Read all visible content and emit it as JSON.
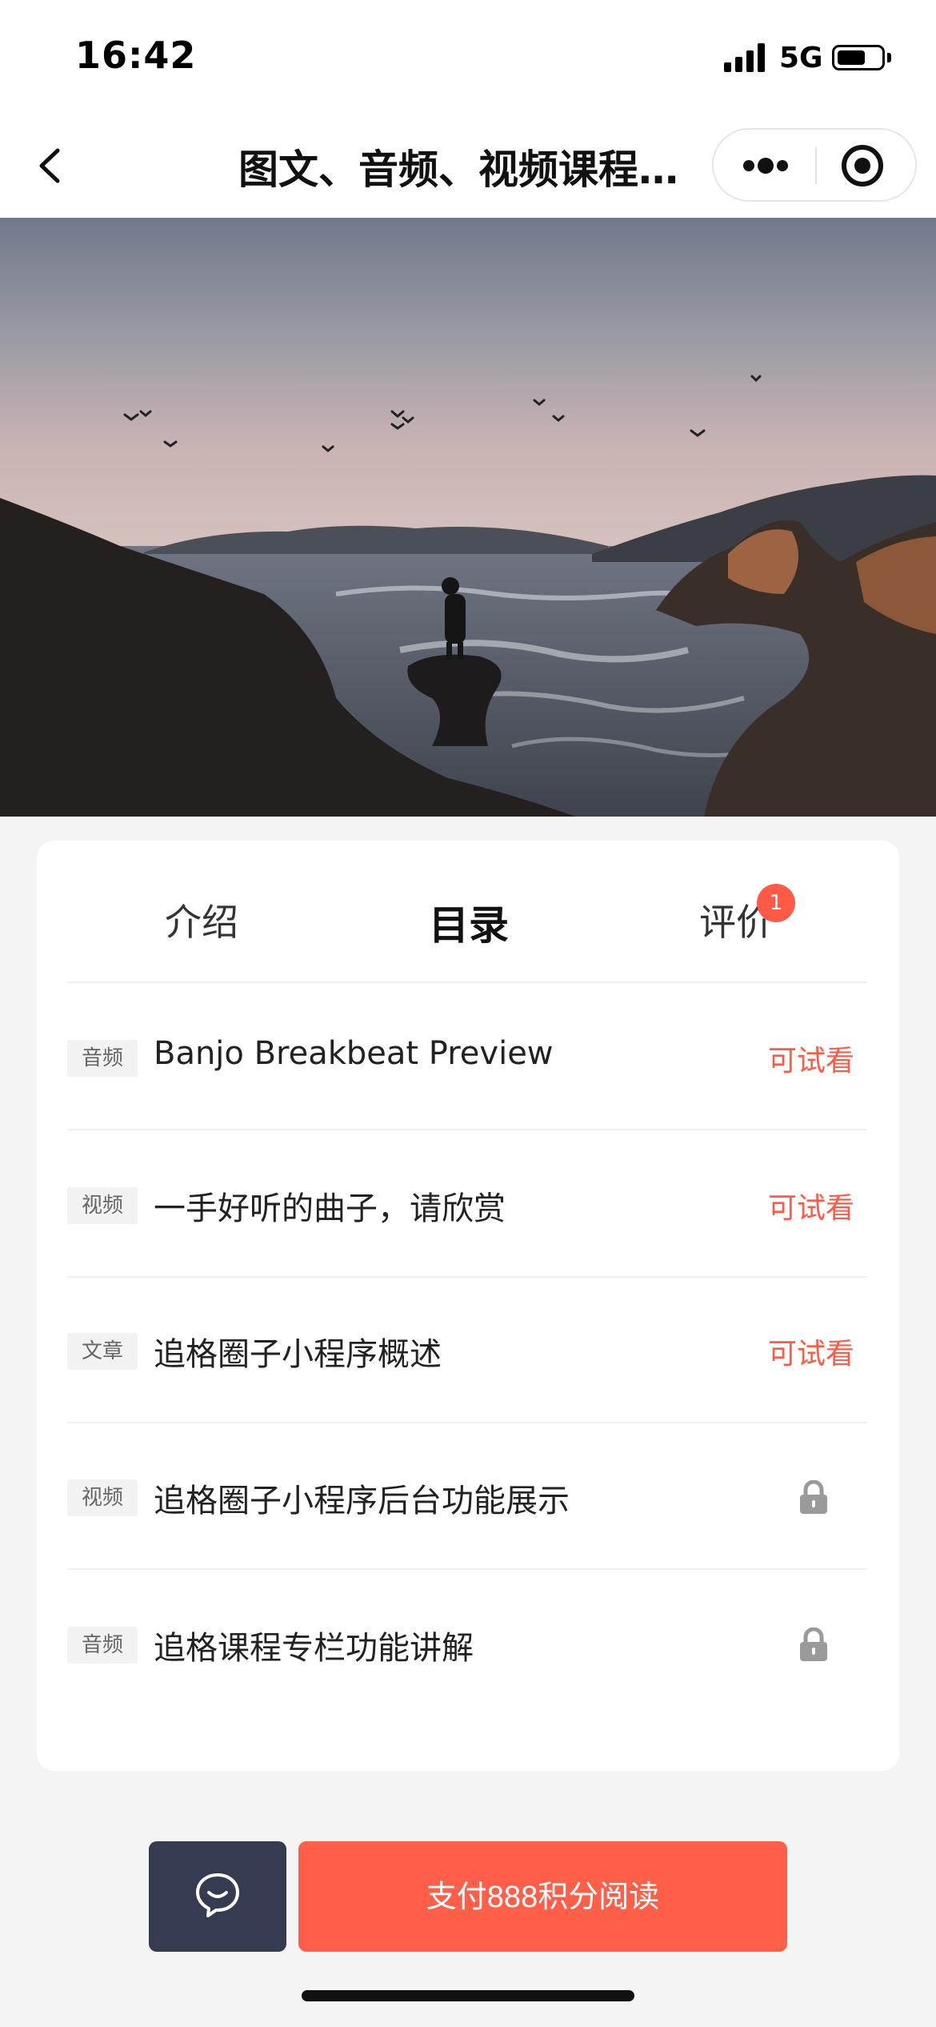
{
  "status_bar": {
    "time": "16:42",
    "network": "5G",
    "battery_level": 0.6
  },
  "nav": {
    "title": "图文、音频、视频课程…",
    "back_icon": "chevron-left-icon",
    "more_icon": "more-dots-icon",
    "close_icon": "mini-program-close-icon"
  },
  "hero": {
    "alt": "coast landscape with person standing on rock"
  },
  "tabs": [
    {
      "label": "介绍"
    },
    {
      "label": "目录",
      "active": true
    },
    {
      "label": "评价",
      "badge": "1"
    }
  ],
  "catalog": [
    {
      "tag": "音频",
      "title": "Banjo Breakbeat Preview",
      "action": "可试看"
    },
    {
      "tag": "视频",
      "title": "一手好听的曲子，请欣赏",
      "action": "可试看"
    },
    {
      "tag": "文章",
      "title": "追格圈子小程序概述",
      "action": "可试看"
    },
    {
      "tag": "视频",
      "title": "追格圈子小程序后台功能展示",
      "locked": true
    },
    {
      "tag": "音频",
      "title": "追格课程专栏功能讲解",
      "locked": true
    }
  ],
  "bottom": {
    "chat_icon": "chat-bubble-icon",
    "pay_label": "支付888积分阅读"
  },
  "colors": {
    "accent": "#ff5e48",
    "chat_btn": "#353b50"
  }
}
